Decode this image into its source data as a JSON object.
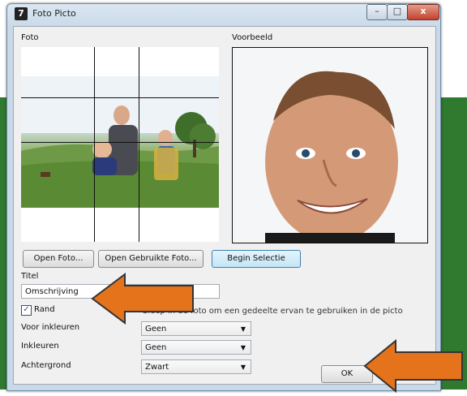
{
  "window": {
    "title": "Foto Picto",
    "app_icon_glyph": "7",
    "controls": {
      "minimize": "–",
      "maximize": "□",
      "close": "x"
    }
  },
  "labels": {
    "foto": "Foto",
    "voorbeeld": "Voorbeeld",
    "titel": "Titel",
    "voor_inkleuren": "Voor inkleuren",
    "inkleuren": "Inkleuren",
    "achtergrond": "Achtergrond"
  },
  "buttons": {
    "open_foto": "Open Foto...",
    "open_gebruikte_foto": "Open Gebruikte Foto...",
    "begin_selectie": "Begin Selectie",
    "ok": "OK"
  },
  "title_field": {
    "value": "Omschrijving"
  },
  "rand": {
    "label": "Rand",
    "checked": "✓"
  },
  "hint": "Sleep in de foto om een gedeelte ervan te gebruiken in de picto",
  "selects": {
    "voor_inkleuren": "Geen",
    "inkleuren": "Geen",
    "achtergrond": "Zwart"
  },
  "icons": {
    "dropdown": "▼"
  },
  "colors": {
    "arrow": "#e4731c",
    "arrow_outline": "#333333",
    "desktop_green": "#2f7a2f",
    "close_button": "#c2432e"
  }
}
